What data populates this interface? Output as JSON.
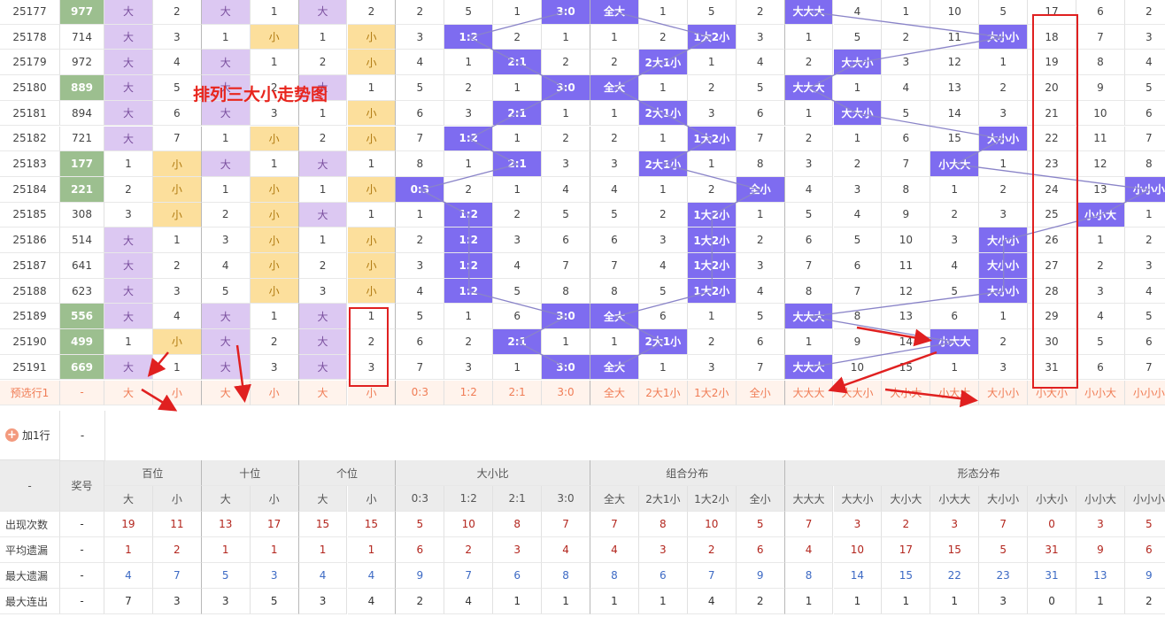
{
  "title_overlay": "排列三大小走势图",
  "columns": [
    "百位大",
    "百位小",
    "十位大",
    "十位小",
    "个位大",
    "个位小",
    "0:3",
    "1:2",
    "2:1",
    "3:0",
    "全大",
    "2大1小",
    "1大2小",
    "全小",
    "大大大",
    "大大小",
    "大小大",
    "小大大",
    "大小小",
    "小大小",
    "小小大",
    "小小小"
  ],
  "rows": [
    {
      "issue": "25177",
      "award": "977",
      "hl": true,
      "cells": [
        "大",
        "2",
        "大",
        "1",
        "大",
        "2",
        "2",
        "5",
        "1",
        "3:0",
        "全大",
        "1",
        "5",
        "2",
        "大大大",
        "4",
        "1",
        "10",
        "5",
        "17",
        "6",
        "2"
      ]
    },
    {
      "issue": "25178",
      "award": "714",
      "hl": false,
      "cells": [
        "大",
        "3",
        "1",
        "小",
        "1",
        "小",
        "3",
        "1:2",
        "2",
        "1",
        "1",
        "2",
        "1大2小",
        "3",
        "1",
        "5",
        "2",
        "11",
        "大小小",
        "18",
        "7",
        "3"
      ]
    },
    {
      "issue": "25179",
      "award": "972",
      "hl": false,
      "cells": [
        "大",
        "4",
        "大",
        "1",
        "2",
        "小",
        "4",
        "1",
        "2:1",
        "2",
        "2",
        "2大1小",
        "1",
        "4",
        "2",
        "大大小",
        "3",
        "12",
        "1",
        "19",
        "8",
        "4"
      ]
    },
    {
      "issue": "25180",
      "award": "889",
      "hl": true,
      "cells": [
        "大",
        "5",
        "大",
        "2",
        "大",
        "1",
        "5",
        "2",
        "1",
        "3:0",
        "全大",
        "1",
        "2",
        "5",
        "大大大",
        "1",
        "4",
        "13",
        "2",
        "20",
        "9",
        "5"
      ]
    },
    {
      "issue": "25181",
      "award": "894",
      "hl": false,
      "cells": [
        "大",
        "6",
        "大",
        "3",
        "1",
        "小",
        "6",
        "3",
        "2:1",
        "1",
        "1",
        "2大1小",
        "3",
        "6",
        "1",
        "大大小",
        "5",
        "14",
        "3",
        "21",
        "10",
        "6"
      ]
    },
    {
      "issue": "25182",
      "award": "721",
      "hl": false,
      "cells": [
        "大",
        "7",
        "1",
        "小",
        "2",
        "小",
        "7",
        "1:2",
        "1",
        "2",
        "2",
        "1",
        "1大2小",
        "7",
        "2",
        "1",
        "6",
        "15",
        "大小小",
        "22",
        "11",
        "7"
      ]
    },
    {
      "issue": "25183",
      "award": "177",
      "hl": true,
      "cells": [
        "1",
        "小",
        "大",
        "1",
        "大",
        "1",
        "8",
        "1",
        "2:1",
        "3",
        "3",
        "2大1小",
        "1",
        "8",
        "3",
        "2",
        "7",
        "小大大",
        "1",
        "23",
        "12",
        "8"
      ]
    },
    {
      "issue": "25184",
      "award": "221",
      "hl": true,
      "cells": [
        "2",
        "小",
        "1",
        "小",
        "1",
        "小",
        "0:3",
        "2",
        "1",
        "4",
        "4",
        "1",
        "2",
        "全小",
        "4",
        "3",
        "8",
        "1",
        "2",
        "24",
        "13",
        "小小小"
      ]
    },
    {
      "issue": "25185",
      "award": "308",
      "hl": false,
      "cells": [
        "3",
        "小",
        "2",
        "小",
        "大",
        "1",
        "1",
        "1:2",
        "2",
        "5",
        "5",
        "2",
        "1大2小",
        "1",
        "5",
        "4",
        "9",
        "2",
        "3",
        "25",
        "小小大",
        "1"
      ]
    },
    {
      "issue": "25186",
      "award": "514",
      "hl": false,
      "cells": [
        "大",
        "1",
        "3",
        "小",
        "1",
        "小",
        "2",
        "1:2",
        "3",
        "6",
        "6",
        "3",
        "1大2小",
        "2",
        "6",
        "5",
        "10",
        "3",
        "大小小",
        "26",
        "1",
        "2"
      ]
    },
    {
      "issue": "25187",
      "award": "641",
      "hl": false,
      "cells": [
        "大",
        "2",
        "4",
        "小",
        "2",
        "小",
        "3",
        "1:2",
        "4",
        "7",
        "7",
        "4",
        "1大2小",
        "3",
        "7",
        "6",
        "11",
        "4",
        "大小小",
        "27",
        "2",
        "3"
      ]
    },
    {
      "issue": "25188",
      "award": "623",
      "hl": false,
      "cells": [
        "大",
        "3",
        "5",
        "小",
        "3",
        "小",
        "4",
        "1:2",
        "5",
        "8",
        "8",
        "5",
        "1大2小",
        "4",
        "8",
        "7",
        "12",
        "5",
        "大小小",
        "28",
        "3",
        "4"
      ]
    },
    {
      "issue": "25189",
      "award": "556",
      "hl": true,
      "cells": [
        "大",
        "4",
        "大",
        "1",
        "大",
        "1",
        "5",
        "1",
        "6",
        "3:0",
        "全大",
        "6",
        "1",
        "5",
        "大大大",
        "8",
        "13",
        "6",
        "1",
        "29",
        "4",
        "5"
      ]
    },
    {
      "issue": "25190",
      "award": "499",
      "hl": true,
      "cells": [
        "1",
        "小",
        "大",
        "2",
        "大",
        "2",
        "6",
        "2",
        "2:1",
        "1",
        "1",
        "2大1小",
        "2",
        "6",
        "1",
        "9",
        "14",
        "小大大",
        "2",
        "30",
        "5",
        "6"
      ]
    },
    {
      "issue": "25191",
      "award": "669",
      "hl": true,
      "cells": [
        "大",
        "1",
        "大",
        "3",
        "大",
        "3",
        "7",
        "3",
        "1",
        "3:0",
        "全大",
        "1",
        "3",
        "7",
        "大大大",
        "10",
        "15",
        "1",
        "3",
        "31",
        "6",
        "7"
      ]
    }
  ],
  "preselect": {
    "label": "预选行1",
    "dash": "-",
    "cells": [
      "大",
      "小",
      "大",
      "小",
      "大",
      "小",
      "0:3",
      "1:2",
      "2:1",
      "3:0",
      "全大",
      "2大1小",
      "1大2小",
      "全小",
      "大大大",
      "大大小",
      "大小大",
      "小大大",
      "大小小",
      "小大小",
      "小小大",
      "小小小"
    ]
  },
  "add_row": {
    "label": "加1行",
    "dash": "-"
  },
  "header": {
    "dash": "-",
    "award_label": "奖号",
    "groups": [
      {
        "label": "百位",
        "span": 2
      },
      {
        "label": "十位",
        "span": 2
      },
      {
        "label": "个位",
        "span": 2
      },
      {
        "label": "大小比",
        "span": 4
      },
      {
        "label": "组合分布",
        "span": 4
      },
      {
        "label": "形态分布",
        "span": 8
      }
    ],
    "subs": [
      "大",
      "小",
      "大",
      "小",
      "大",
      "小",
      "0:3",
      "1:2",
      "2:1",
      "3:0",
      "全大",
      "2大1小",
      "1大2小",
      "全小",
      "大大大",
      "大大小",
      "大小大",
      "小大大",
      "大小小",
      "小大小",
      "小小大",
      "小小小"
    ]
  },
  "stats": [
    {
      "label": "出现次数",
      "dash": "-",
      "color": "#b3261e",
      "values": [
        "19",
        "11",
        "13",
        "17",
        "15",
        "15",
        "5",
        "10",
        "8",
        "7",
        "7",
        "8",
        "10",
        "5",
        "7",
        "3",
        "2",
        "3",
        "7",
        "0",
        "3",
        "5"
      ]
    },
    {
      "label": "平均遗漏",
      "dash": "-",
      "color": "#b3261e",
      "values": [
        "1",
        "2",
        "1",
        "1",
        "1",
        "1",
        "6",
        "2",
        "3",
        "4",
        "4",
        "3",
        "2",
        "6",
        "4",
        "10",
        "17",
        "15",
        "5",
        "31",
        "9",
        "6"
      ]
    },
    {
      "label": "最大遗漏",
      "dash": "-",
      "color": "#3d6ac4",
      "values": [
        "4",
        "7",
        "5",
        "3",
        "4",
        "4",
        "9",
        "7",
        "6",
        "8",
        "8",
        "6",
        "7",
        "9",
        "8",
        "14",
        "15",
        "22",
        "23",
        "31",
        "13",
        "9"
      ]
    },
    {
      "label": "最大连出",
      "dash": "-",
      "color": "#333333",
      "values": [
        "7",
        "3",
        "3",
        "5",
        "3",
        "4",
        "2",
        "4",
        "1",
        "1",
        "1",
        "1",
        "4",
        "2",
        "1",
        "1",
        "1",
        "1",
        "3",
        "0",
        "1",
        "2"
      ]
    }
  ]
}
